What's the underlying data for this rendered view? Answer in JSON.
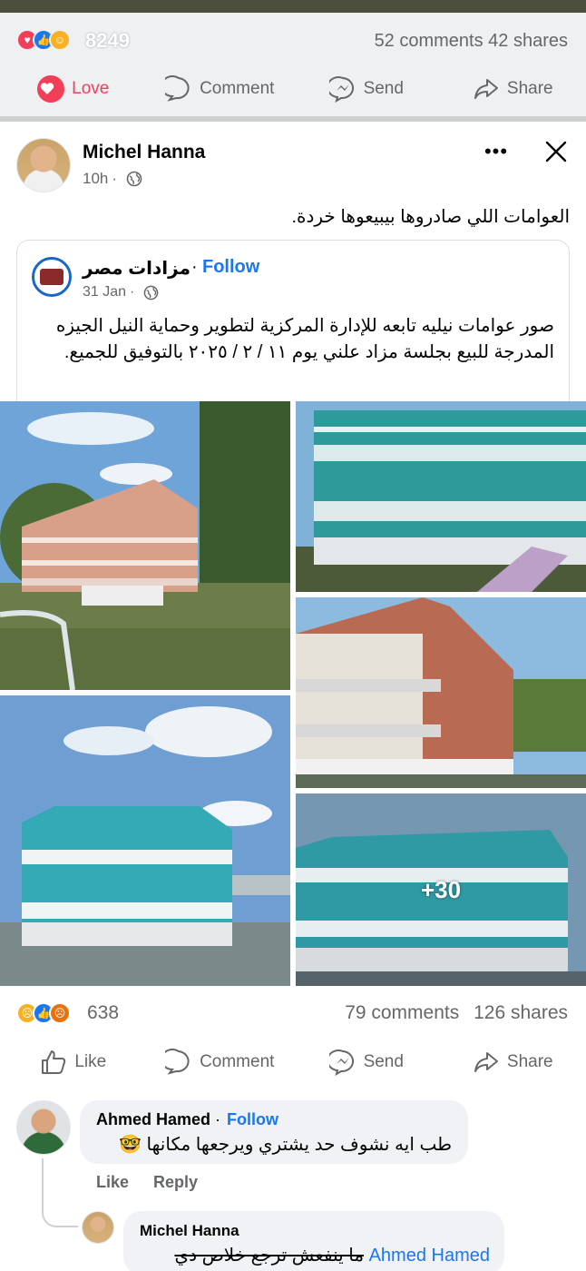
{
  "top_stats": {
    "reaction_count": "8249",
    "comments_shares": "52 comments  42 shares"
  },
  "top_actions": {
    "love": "Love",
    "comment": "Comment",
    "send": "Send",
    "share": "Share"
  },
  "post": {
    "author": "Michel Hanna",
    "time": "10h",
    "text": "العوامات اللي صادروها بيبيعوها خردة."
  },
  "shared": {
    "page_name": "مزادات مصر",
    "follow": "Follow",
    "date": "31 Jan",
    "text": "صور عوامات نيليه تابعه للإدارة المركزية لتطوير وحماية النيل الجيزه المدرجة للبيع بجلسة مزاد علني يوم ١١ / ٢ / ٢٠٢٥ بالتوفيق للجميع."
  },
  "photos": {
    "more_count": "+30"
  },
  "reactions": {
    "count": "638",
    "comments": "79 comments",
    "shares": "126 shares"
  },
  "actions": {
    "like": "Like",
    "comment": "Comment",
    "send": "Send",
    "share": "Share"
  },
  "comment": {
    "author": "Ahmed Hamed",
    "follow": "Follow",
    "text": "طب ايه نشوف حد يشتري ويرجعها مكانها 🤓",
    "like": "Like",
    "reply": "Reply"
  },
  "reply": {
    "author": "Michel Hanna",
    "mention": "Ahmed Hamed",
    "text": "ما ينفعش ترجع خلاص دي"
  },
  "colors": {
    "accent": "#1877f2",
    "love": "#f33e58",
    "muted_text": "#65676b"
  }
}
